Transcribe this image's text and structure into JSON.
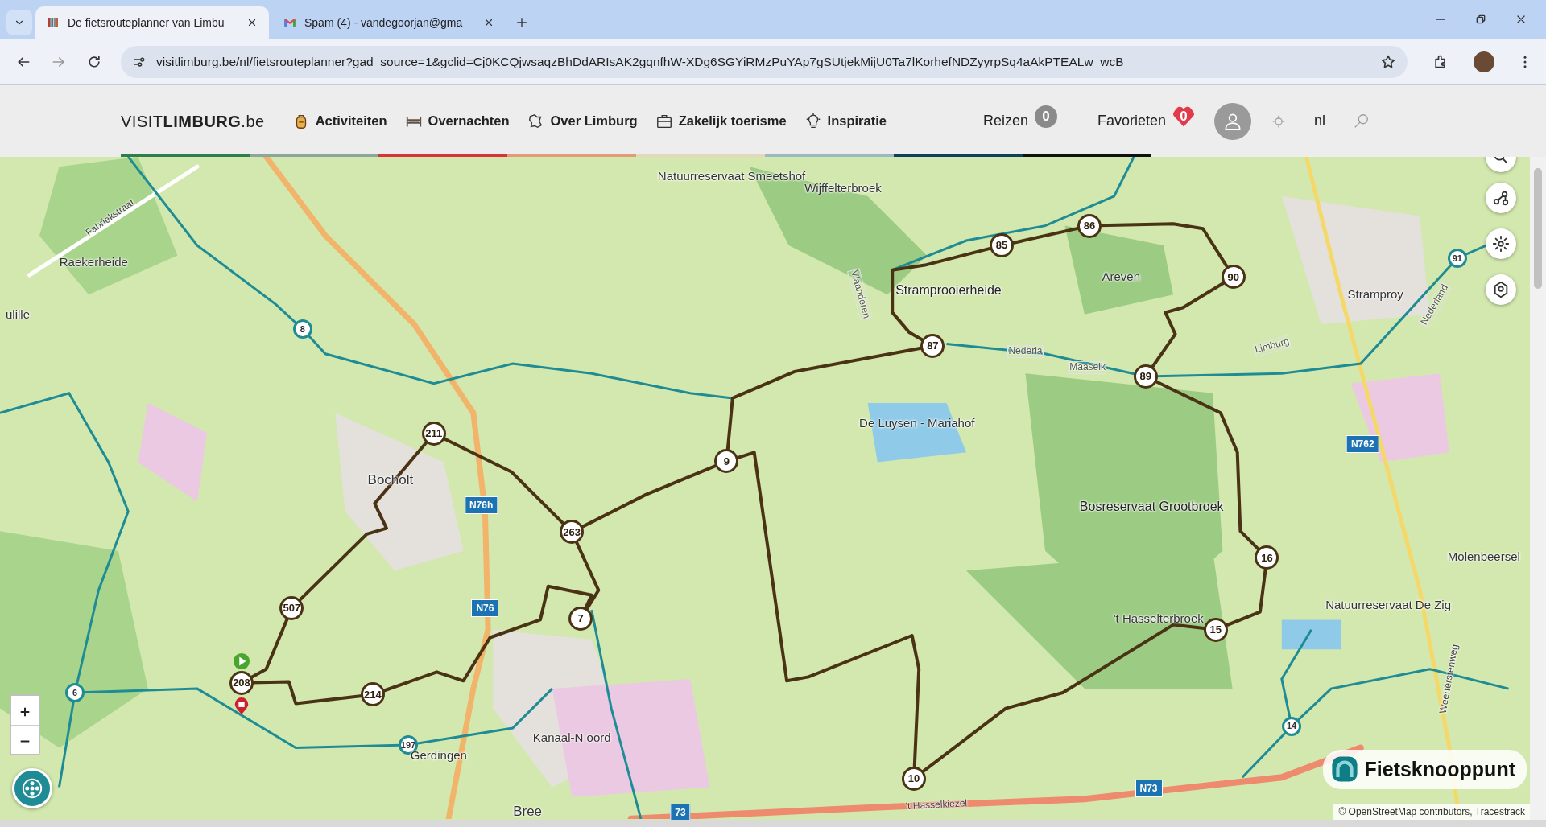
{
  "browser": {
    "tabs": [
      {
        "title": "De fietsrouteplanner van Limbu",
        "selected": true,
        "kind": "site"
      },
      {
        "title": "Spam (4) - vandegoorjan@gma",
        "selected": false,
        "kind": "mail"
      }
    ],
    "url": "visitlimburg.be/nl/fietsrouteplanner?gad_source=1&gclid=Cj0KCQjwsaqzBhDdARIsAK2gqnfhW-XDg6SGYiRMzPuYAp7gSUtjekMijU0Ta7lKorhefNDZyyrpSq4aAkPTEALw_wcB"
  },
  "site_header": {
    "logo": "VISIT**LIMBURG**.be",
    "nav": [
      {
        "label": "Activiteiten",
        "kind": "backpack"
      },
      {
        "label": "Overnachten",
        "kind": "bed"
      },
      {
        "label": "Over Limburg",
        "kind": "map"
      },
      {
        "label": "Zakelijk toerisme",
        "kind": "briefcase"
      },
      {
        "label": "Inspiratie",
        "kind": "bulb"
      }
    ],
    "trips": {
      "label": "Reizen",
      "count": "0"
    },
    "favorites": {
      "label": "Favorieten",
      "count": "0"
    },
    "language": "nl"
  },
  "map": {
    "nodes": [
      {
        "label": "211",
        "kind": "route"
      },
      {
        "label": "263",
        "kind": "route"
      },
      {
        "label": "9",
        "kind": "route"
      },
      {
        "label": "87",
        "kind": "route"
      },
      {
        "label": "85",
        "kind": "route"
      },
      {
        "label": "86",
        "kind": "route"
      },
      {
        "label": "90",
        "kind": "route"
      },
      {
        "label": "89",
        "kind": "route"
      },
      {
        "label": "16",
        "kind": "route"
      },
      {
        "label": "15",
        "kind": "route"
      },
      {
        "label": "10",
        "kind": "route"
      },
      {
        "label": "7",
        "kind": "route"
      },
      {
        "label": "214",
        "kind": "route"
      },
      {
        "label": "208",
        "kind": "route"
      },
      {
        "label": "507",
        "kind": "route"
      },
      {
        "label": "8",
        "kind": "network"
      },
      {
        "label": "6",
        "kind": "network"
      },
      {
        "label": "197",
        "kind": "network"
      },
      {
        "label": "14",
        "kind": "network"
      },
      {
        "label": "91",
        "kind": "network"
      }
    ],
    "places": [
      {
        "text": "Fabriekstraat",
        "kind": "street"
      },
      {
        "text": "Raekerheide",
        "kind": "place"
      },
      {
        "text": "ulille",
        "kind": "place"
      },
      {
        "text": "Bocholt",
        "kind": "town"
      },
      {
        "text": "Natuurreservaat Smeetshof",
        "kind": "place"
      },
      {
        "text": "Wijffelterbroek",
        "kind": "place"
      },
      {
        "text": "Vlaanderen",
        "kind": "border"
      },
      {
        "text": "Stramprooierheide",
        "kind": "area"
      },
      {
        "text": "Areven",
        "kind": "place"
      },
      {
        "text": "Nederla",
        "kind": "border"
      },
      {
        "text": "Maaseik",
        "kind": "border"
      },
      {
        "text": "De Luysen - Mariahof",
        "kind": "place"
      },
      {
        "text": "Bosreservaat Grootbroek",
        "kind": "area"
      },
      {
        "text": "'t Hasselterbroek",
        "kind": "place"
      },
      {
        "text": "Limburg",
        "kind": "border"
      },
      {
        "text": "Stramproy",
        "kind": "place"
      },
      {
        "text": "Nederland",
        "kind": "border"
      },
      {
        "text": "Molenbeersel",
        "kind": "place"
      },
      {
        "text": "Natuurreservaat De Zig",
        "kind": "place"
      },
      {
        "text": "Weerterstenweg",
        "kind": "street"
      },
      {
        "text": "Kanaal-N oord",
        "kind": "place"
      },
      {
        "text": "Gerdingen",
        "kind": "place"
      },
      {
        "text": "Bree",
        "kind": "town"
      },
      {
        "text": "'t Hasselkiezel",
        "kind": "street"
      }
    ],
    "roads": [
      "N76h",
      "N76",
      "N762",
      "N73",
      "73"
    ],
    "brand": "Fietsknooppunt",
    "attribution": "© OpenStreetMap contributors, Tracestrack"
  }
}
